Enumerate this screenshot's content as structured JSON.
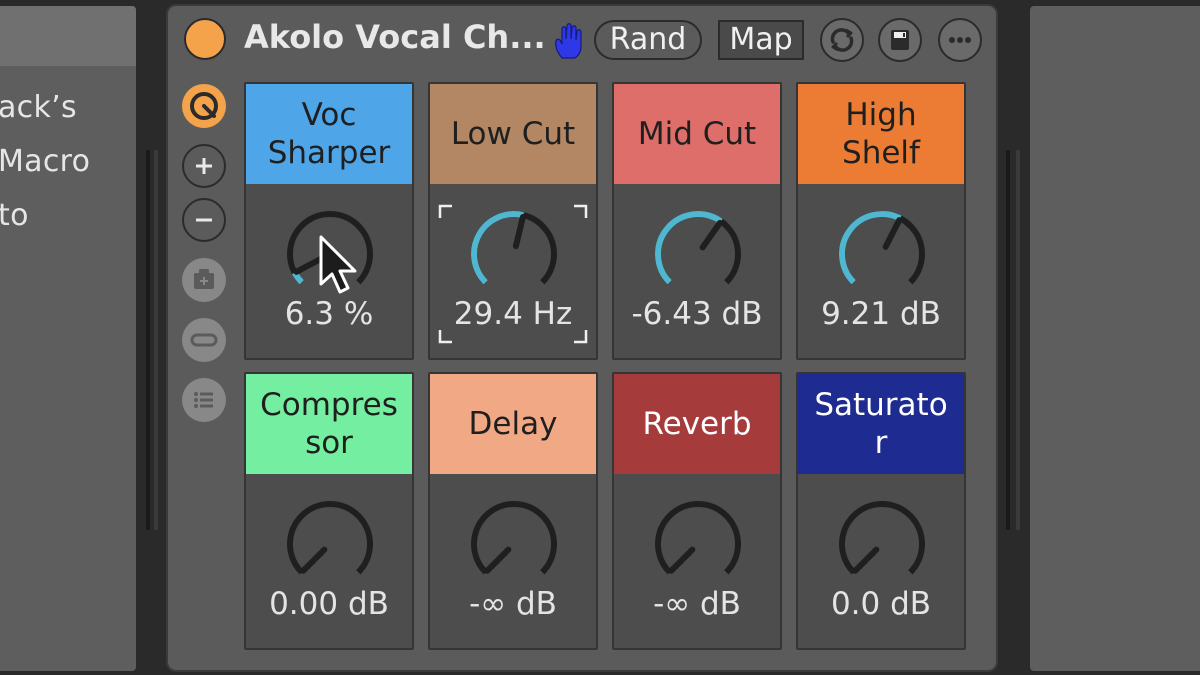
{
  "left_panel": {
    "lines": [
      "ack’s",
      "Macro",
      "to"
    ]
  },
  "device": {
    "title": "Akolo Vocal Ch...",
    "rand_label": "Rand",
    "map_label": "Map",
    "power_color": "#f5a34a",
    "icons": {
      "hand": "hand-icon",
      "refresh": "refresh-icon",
      "save": "save-icon",
      "more": "more-icon"
    },
    "side_controls": [
      "link-icon",
      "plus-icon",
      "minus-icon",
      "add-variation-icon",
      "remove-icon",
      "list-icon"
    ]
  },
  "macros": [
    {
      "name": "Voc\nSharper",
      "value": "6.3 %",
      "color": "#4ea6e8",
      "fill": 0.063,
      "dark": false
    },
    {
      "name": "Low Cut",
      "value": "29.4 Hz",
      "color": "#b48764",
      "fill": 0.55,
      "dark": false
    },
    {
      "name": "Mid Cut",
      "value": "-6.43 dB",
      "color": "#dd6e6a",
      "fill": 0.63,
      "dark": false
    },
    {
      "name": "High\nShelf",
      "value": "9.21 dB",
      "color": "#ec7c34",
      "fill": 0.6,
      "dark": false
    },
    {
      "name": "Compres\nsor",
      "value": "0.00 dB",
      "color": "#74eea0",
      "fill": 0.0,
      "dark": false
    },
    {
      "name": "Delay",
      "value": "-∞ dB",
      "color": "#f1a884",
      "fill": 0.0,
      "dark": false
    },
    {
      "name": "Reverb",
      "value": "-∞ dB",
      "color": "#a53b3b",
      "fill": 0.0,
      "dark": true
    },
    {
      "name": "Saturato\nr",
      "value": "0.0 dB",
      "color": "#1e2c92",
      "fill": 0.0,
      "dark": true
    }
  ],
  "knob_arc_color": "#4fb7cf"
}
